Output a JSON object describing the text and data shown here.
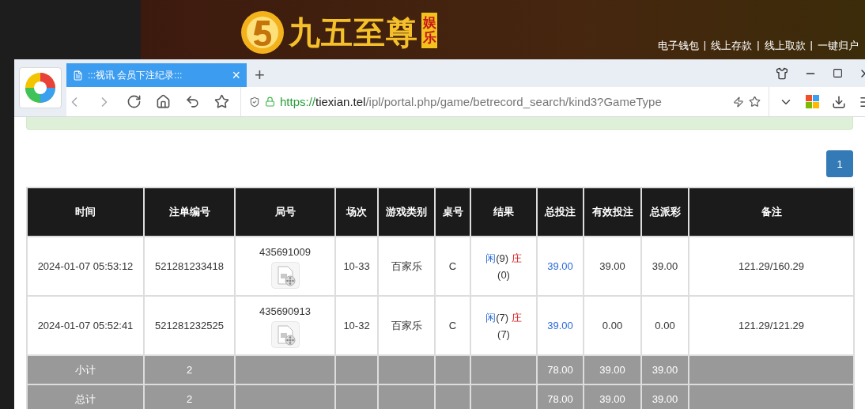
{
  "site": {
    "logo_title": "九五至尊",
    "logo_tag": "娱乐",
    "links": [
      "电子钱包",
      "线上存款",
      "线上取款",
      "一键归户"
    ],
    "separator": "|"
  },
  "browser": {
    "tab": {
      "title": ":::视讯 会员下注纪录:::",
      "selected": true,
      "close": "×"
    },
    "new_tab": "+",
    "url": {
      "scheme": "https://",
      "host": "tiexian.tel",
      "path": "/ipl/portal.php/game/betrecord_search/kind3?GameType"
    }
  },
  "pagination": [
    {
      "label": "1",
      "selected": true
    }
  ],
  "table": {
    "columns": [
      "时间",
      "注单编号",
      "局号",
      "场次",
      "游戏类别",
      "桌号",
      "结果",
      "总投注",
      "有效投注",
      "总派彩",
      "备注"
    ],
    "rows": [
      {
        "time": "2024-01-07 05:53:12",
        "bet_id": "521281233418",
        "round": "435691009",
        "session": "10-33",
        "game": "百家乐",
        "desk": "C",
        "result": {
          "player": "闲",
          "player_score": "(9)",
          "banker": "庄",
          "banker_score": "(0)"
        },
        "total_bet": "39.00",
        "valid_bet": "39.00",
        "payout": "39.00",
        "note": "121.29/160.29"
      },
      {
        "time": "2024-01-07 05:52:41",
        "bet_id": "521281232525",
        "round": "435690913",
        "session": "10-32",
        "game": "百家乐",
        "desk": "C",
        "result": {
          "player": "闲",
          "player_score": "(7)",
          "banker": "庄",
          "banker_score": "(7)"
        },
        "total_bet": "39.00",
        "valid_bet": "0.00",
        "payout": "0.00",
        "note": "121.29/121.29"
      }
    ],
    "totals": [
      {
        "label": "小计",
        "count": "2",
        "total_bet": "78.00",
        "valid_bet": "39.00",
        "payout": "39.00"
      },
      {
        "label": "总计",
        "count": "2",
        "total_bet": "78.00",
        "valid_bet": "39.00",
        "payout": "39.00"
      }
    ]
  }
}
